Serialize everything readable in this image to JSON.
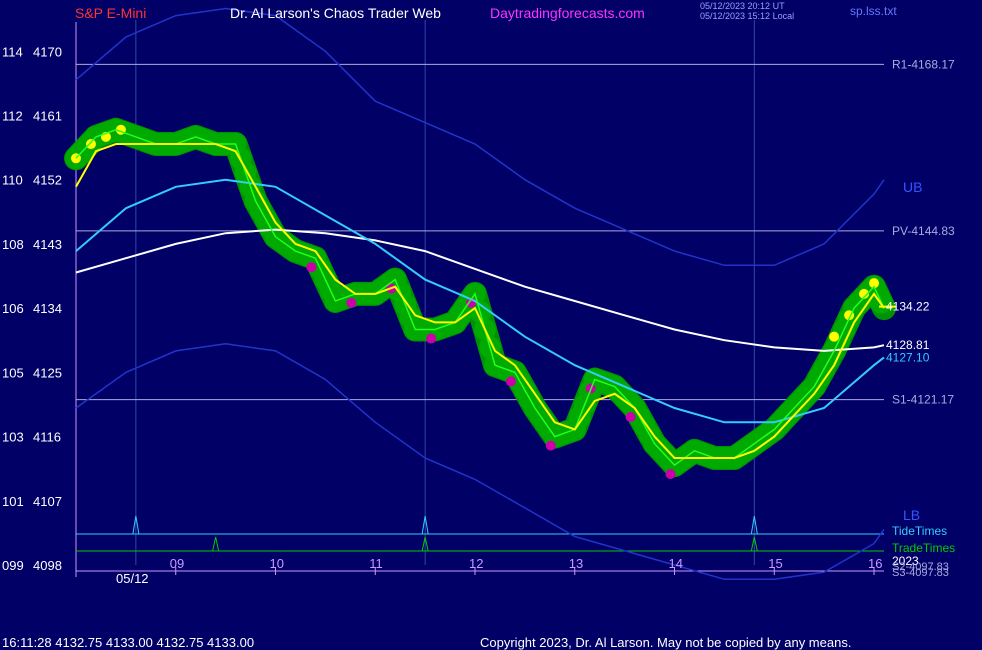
{
  "header": {
    "symbol": "S&P E-Mini",
    "title": "Dr. Al Larson's Chaos Trader Web",
    "website": "Daytradingforecasts.com",
    "ut_stamp": "05/12/2023 20:12 UT",
    "local_stamp": "05/12/2023 15:12 Local",
    "data_file": "sp.lss.txt"
  },
  "footer": {
    "quote": "16:11:28  4132.75 4133.00 4132.75 4133.00",
    "copyright": "Copyright 2023, Dr. Al Larson. May not be copied by any means."
  },
  "colors": {
    "background": "#000066",
    "price_line": "#00cc00",
    "glow": "#009900",
    "fast_avg": "#ffff00",
    "mid_avg": "#33ccff",
    "slow_avg": "#ffffff",
    "bands": "#2233cc",
    "levels": "#aaaadd",
    "magenta": "#cc00aa",
    "tide": "#33ccff",
    "trade": "#00cc00",
    "ticks": "#cc99ff"
  },
  "chart_data": {
    "type": "line",
    "xlabel": "",
    "ylabel": "",
    "x_ticks": [
      "09",
      "10",
      "11",
      "12",
      "13",
      "14",
      "15",
      "16"
    ],
    "date_label": "05/12",
    "ylim": [
      4098,
      4172
    ],
    "y_ticks": [
      {
        "left": "114",
        "right": "4170",
        "value": 4170
      },
      {
        "left": "112",
        "right": "4161",
        "value": 4161
      },
      {
        "left": "110",
        "right": "4152",
        "value": 4152
      },
      {
        "left": "108",
        "right": "4143",
        "value": 4143
      },
      {
        "left": "106",
        "right": "4134",
        "value": 4134
      },
      {
        "left": "105",
        "right": "4125",
        "value": 4125
      },
      {
        "left": "103",
        "right": "4116",
        "value": 4116
      },
      {
        "left": "101",
        "right": "4107",
        "value": 4107
      },
      {
        "left": "099",
        "right": "4098",
        "value": 4098
      }
    ],
    "levels": [
      {
        "label": "R1-4168.17",
        "value": 4168.17
      },
      {
        "label": "PV-4144.83",
        "value": 4144.83
      },
      {
        "label": "S1-4121.17",
        "value": 4121.17
      }
    ],
    "right_labels": [
      {
        "text": "UB",
        "color": "#3355ff"
      },
      {
        "text": "LB",
        "color": "#3355ff"
      },
      {
        "text": "TideTimes",
        "color": "#33ccff"
      },
      {
        "text": "TradeTimes",
        "color": "#00cc00"
      },
      {
        "text": "2023",
        "color": "#ffffff"
      },
      {
        "text": "S2-4097.83",
        "color": "#aaaadd"
      },
      {
        "text": "S3-4097.83",
        "color": "#aaaadd"
      }
    ],
    "value_labels": [
      {
        "text": "4134.22",
        "value": 4134.22,
        "color": "#ffffff"
      },
      {
        "text": "4128.81",
        "value": 4128.81,
        "color": "#ffffff"
      },
      {
        "text": "4127.10",
        "value": 4127.1,
        "color": "#33ccff"
      }
    ],
    "tide_times": [
      8.6,
      11.5,
      14.8
    ],
    "trade_times": [
      9.4,
      11.5,
      14.8
    ],
    "series": [
      {
        "key": "price",
        "x": [
          8.0,
          8.2,
          8.4,
          8.6,
          8.8,
          9.0,
          9.2,
          9.4,
          9.6,
          9.8,
          10.0,
          10.2,
          10.4,
          10.6,
          10.8,
          11.0,
          11.2,
          11.4,
          11.6,
          11.8,
          12.0,
          12.2,
          12.4,
          12.6,
          12.8,
          13.0,
          13.2,
          13.4,
          13.6,
          13.8,
          14.0,
          14.2,
          14.4,
          14.6,
          14.8,
          15.0,
          15.2,
          15.4,
          15.6,
          15.8,
          16.0,
          16.1
        ],
        "y": [
          4155,
          4158,
          4159,
          4158,
          4157,
          4157,
          4158,
          4157,
          4157,
          4149,
          4144,
          4142,
          4141,
          4135,
          4136,
          4136,
          4138,
          4131,
          4131,
          4132,
          4136,
          4126,
          4125,
          4120,
          4116,
          4117,
          4124,
          4123,
          4120,
          4115,
          4112,
          4114,
          4113,
          4113,
          4115,
          4117,
          4120,
          4123,
          4128,
          4134,
          4137,
          4134
        ]
      },
      {
        "key": "fast_avg",
        "x": [
          8.0,
          8.2,
          8.4,
          8.6,
          8.8,
          9.0,
          9.2,
          9.4,
          9.6,
          9.8,
          10.0,
          10.2,
          10.4,
          10.6,
          10.8,
          11.0,
          11.2,
          11.4,
          11.6,
          11.8,
          12.0,
          12.2,
          12.4,
          12.6,
          12.8,
          13.0,
          13.2,
          13.4,
          13.6,
          13.8,
          14.0,
          14.2,
          14.4,
          14.6,
          14.8,
          15.0,
          15.2,
          15.4,
          15.6,
          15.8,
          16.0,
          16.1
        ],
        "y": [
          4151,
          4156,
          4157,
          4157,
          4157,
          4157,
          4157,
          4157,
          4156,
          4151,
          4146,
          4143,
          4142,
          4138,
          4136,
          4136,
          4137,
          4133,
          4132,
          4132,
          4134,
          4128,
          4126,
          4122,
          4118,
          4117,
          4121,
          4122,
          4120,
          4116,
          4113,
          4113,
          4113,
          4113,
          4114,
          4116,
          4119,
          4122,
          4126,
          4132,
          4136,
          4134
        ]
      },
      {
        "key": "mid_avg",
        "x": [
          8.0,
          8.5,
          9.0,
          9.5,
          10.0,
          10.5,
          11.0,
          11.5,
          12.0,
          12.5,
          13.0,
          13.5,
          14.0,
          14.5,
          15.0,
          15.5,
          16.0,
          16.1
        ],
        "y": [
          4142,
          4148,
          4151,
          4152,
          4151,
          4147,
          4143,
          4138,
          4135,
          4130,
          4126,
          4123,
          4120,
          4118,
          4118,
          4120,
          4126,
          4127.1
        ]
      },
      {
        "key": "slow_avg",
        "x": [
          8.0,
          8.5,
          9.0,
          9.5,
          10.0,
          10.5,
          11.0,
          11.5,
          12.0,
          12.5,
          13.0,
          13.5,
          14.0,
          14.5,
          15.0,
          15.5,
          16.0,
          16.1
        ],
        "y": [
          4139,
          4141,
          4143,
          4144.5,
          4145,
          4144.5,
          4143.5,
          4142,
          4139.5,
          4137,
          4135,
          4133,
          4131,
          4129.5,
          4128.5,
          4128,
          4128.5,
          4128.81
        ]
      },
      {
        "key": "upper_band",
        "x": [
          8.0,
          8.5,
          9.0,
          9.5,
          10.0,
          10.5,
          11.0,
          11.5,
          12.0,
          12.5,
          13.0,
          13.5,
          14.0,
          14.5,
          15.0,
          15.5,
          16.0,
          16.1
        ],
        "y": [
          4166,
          4172,
          4175,
          4176,
          4175,
          4170,
          4163,
          4160,
          4157,
          4152,
          4148,
          4145,
          4142,
          4140,
          4140,
          4143,
          4150,
          4152
        ]
      },
      {
        "key": "lower_band",
        "x": [
          8.0,
          8.5,
          9.0,
          9.5,
          10.0,
          10.5,
          11.0,
          11.5,
          12.0,
          12.5,
          13.0,
          13.5,
          14.0,
          14.5,
          15.0,
          15.5,
          16.0,
          16.1
        ],
        "y": [
          4120,
          4125,
          4128,
          4129,
          4128,
          4124,
          4118,
          4113,
          4110,
          4106,
          4102,
          4100,
          4098,
          4096,
          4096,
          4097,
          4101,
          4103
        ]
      }
    ]
  }
}
